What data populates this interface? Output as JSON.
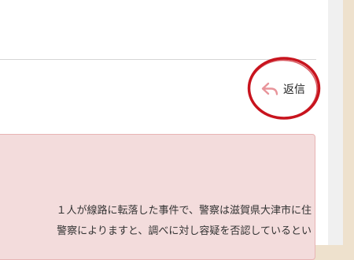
{
  "reply": {
    "label": "返信",
    "icon": "reply-arrow-icon",
    "icon_color": "#e8949a"
  },
  "message": {
    "lines": [
      "１人が線路に転落した事件で、警察は滋賀県大津市に住",
      "警察によりますと、調べに対し容疑を否認しているとい"
    ]
  },
  "colors": {
    "highlight_circle": "#c8141e",
    "message_background": "#f3dcdc",
    "page_side": "#eee1cd"
  }
}
